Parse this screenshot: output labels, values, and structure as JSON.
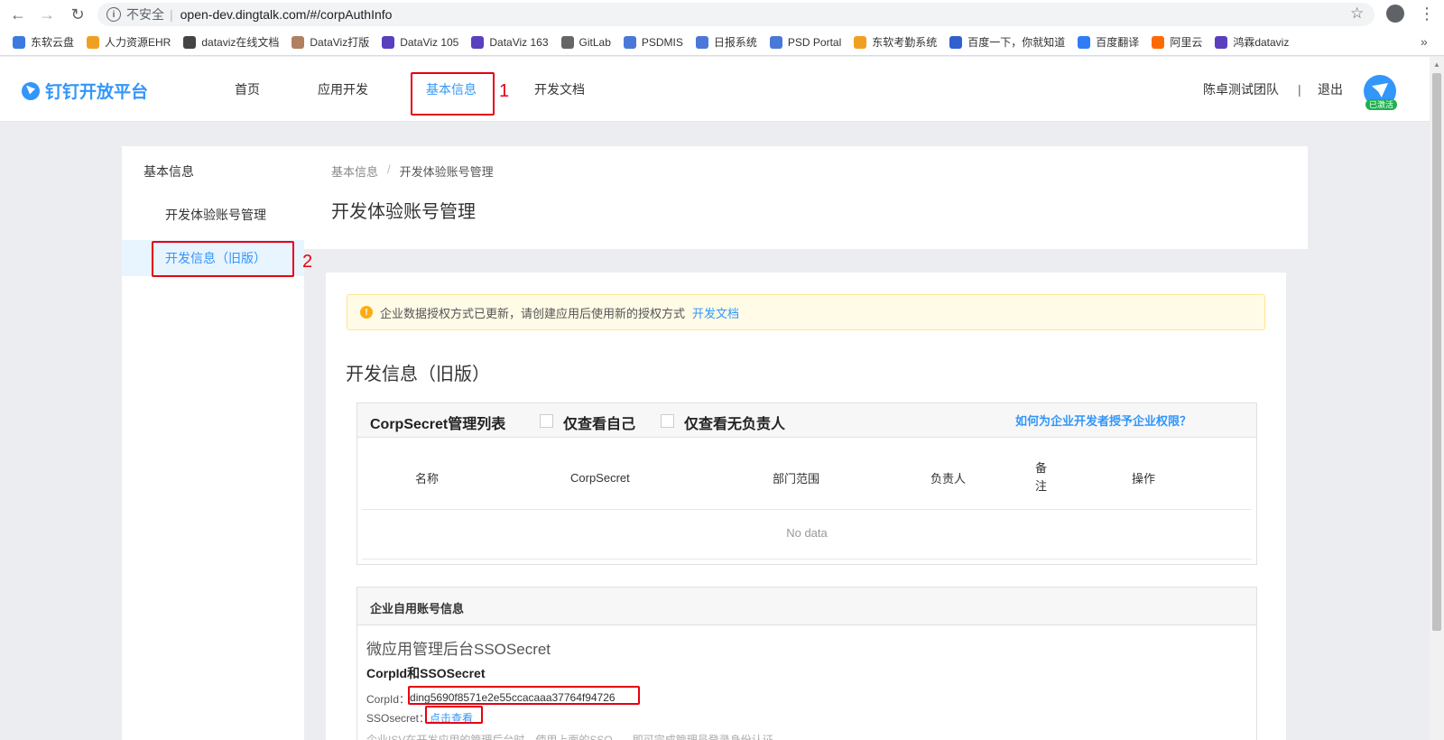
{
  "browser": {
    "insecure_label": "不安全",
    "url": "open-dev.dingtalk.com/#/corpAuthInfo",
    "bookmarks": [
      {
        "label": "东软云盘",
        "color": "#3b7be0"
      },
      {
        "label": "人力资源EHR",
        "color": "#f0a020"
      },
      {
        "label": "dataviz在线文档",
        "color": "#444444"
      },
      {
        "label": "DataViz打版",
        "color": "#b08060"
      },
      {
        "label": "DataViz 105",
        "color": "#5a3fbf"
      },
      {
        "label": "DataViz 163",
        "color": "#5a3fbf"
      },
      {
        "label": "GitLab",
        "color": "#666666"
      },
      {
        "label": "PSDMIS",
        "color": "#4a78d8"
      },
      {
        "label": "日报系统",
        "color": "#4a78d8"
      },
      {
        "label": "PSD Portal",
        "color": "#4a78d8"
      },
      {
        "label": "东软考勤系统",
        "color": "#f0a020"
      },
      {
        "label": "百度一下，你就知道",
        "color": "#3060d0"
      },
      {
        "label": "百度翻译",
        "color": "#2f7cf6"
      },
      {
        "label": "阿里云",
        "color": "#ff6a00"
      },
      {
        "label": "鸿霖dataviz",
        "color": "#5a3fbf"
      }
    ],
    "more": "»"
  },
  "header": {
    "logo_text": "钉钉开放平台",
    "nav": [
      {
        "label": "首页"
      },
      {
        "label": "应用开发"
      },
      {
        "label": "基本信息"
      },
      {
        "label": "开发文档"
      }
    ],
    "team": "陈卓测试团队",
    "divider": "|",
    "logout": "退出",
    "badge": "已激活"
  },
  "annotations": {
    "n1": "1",
    "n2": "2"
  },
  "sidebar": {
    "title": "基本信息",
    "items": [
      {
        "label": "开发体验账号管理"
      },
      {
        "label": "开发信息（旧版）"
      }
    ]
  },
  "breadcrumb": {
    "root": "基本信息",
    "sep": "/",
    "current": "开发体验账号管理"
  },
  "page_title": "开发体验账号管理",
  "alert": {
    "icon": "!",
    "text": "企业数据授权方式已更新，请创建应用后使用新的授权方式",
    "link": "开发文档"
  },
  "section_title": "开发信息（旧版）",
  "corpsecret": {
    "title": "CorpSecret管理列表",
    "filter_self": "仅查看自己",
    "filter_noowner": "仅查看无负责人",
    "help": "如何为企业开发者授予企业权限？",
    "columns": [
      "名称",
      "CorpSecret",
      "部门范围",
      "负责人",
      "备注",
      "操作"
    ],
    "empty": "No data"
  },
  "account": {
    "title": "企业自用账号信息",
    "sso_title": "微应用管理后台SSOSecret",
    "sub_title": "CorpId和SSOSecret",
    "corpid_label": "CorpId：",
    "corpid_value": "ding5690f8571e2e55ccacaaa37764f94726",
    "ssosecret_label": "SSOsecret：",
    "ssosecret_link": "点击查看",
    "faded_note": "企业ISV在开发应用的管理后台时，使用上面的SSO...，即可完成管理员登录身份认证"
  }
}
